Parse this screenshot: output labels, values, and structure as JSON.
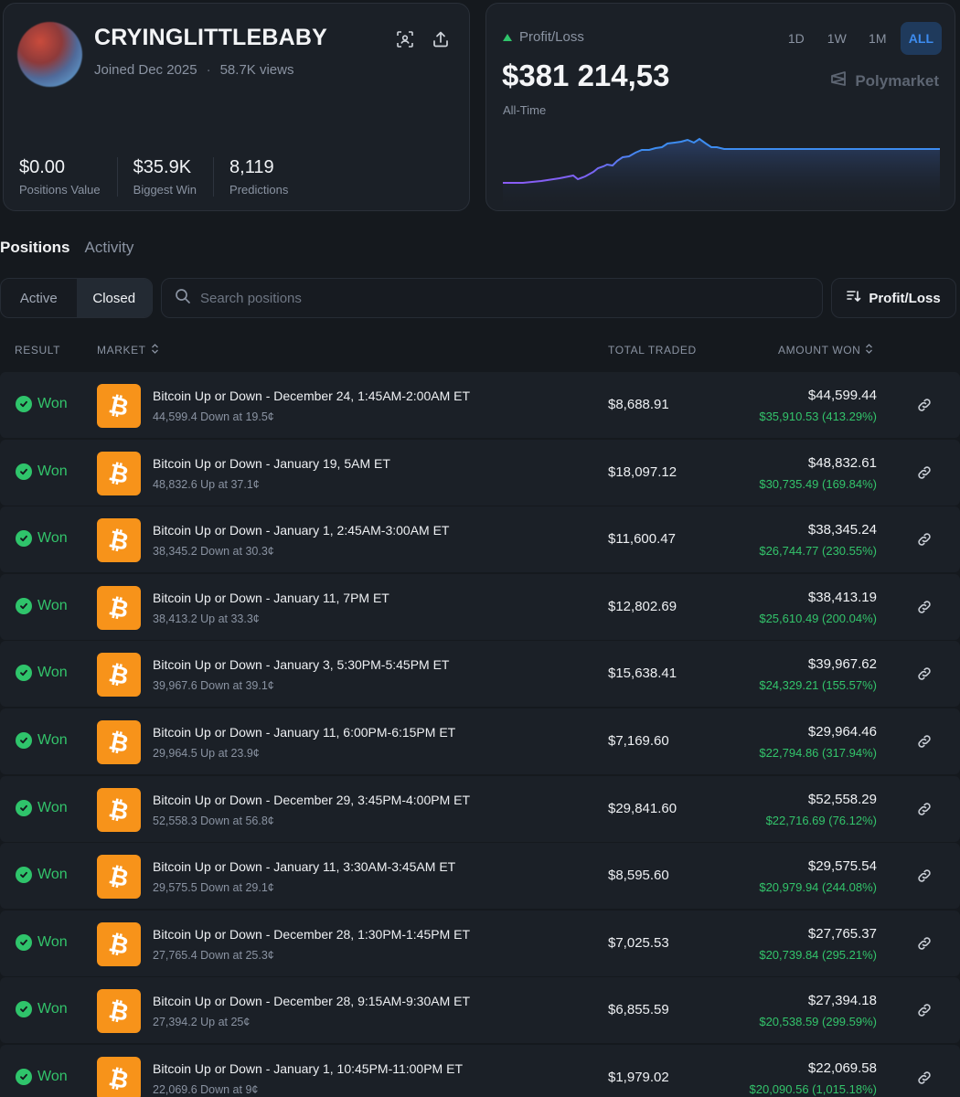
{
  "profile": {
    "username": "CRYINGLITTLEBABY",
    "joined": "Joined Dec 2025",
    "separator": "·",
    "views": "58.7K views",
    "stats": [
      {
        "value": "$0.00",
        "label": "Positions Value"
      },
      {
        "value": "$35.9K",
        "label": "Biggest Win"
      },
      {
        "value": "8,119",
        "label": "Predictions"
      }
    ]
  },
  "pnl": {
    "label": "Profit/Loss",
    "value": "$381 214,53",
    "period": "All-Time",
    "brand": "Polymarket",
    "ranges": [
      "1D",
      "1W",
      "1M",
      "ALL"
    ],
    "active_range": "ALL",
    "colors": {
      "line_start": "#8b5cf6",
      "line_end": "#3d8cf0"
    }
  },
  "tabs": {
    "positions": "Positions",
    "activity": "Activity"
  },
  "filters": {
    "active": "Active",
    "closed": "Closed",
    "search_placeholder": "Search positions",
    "sort_label": "Profit/Loss"
  },
  "table": {
    "headers": {
      "result": "RESULT",
      "market": "MARKET",
      "total_traded": "TOTAL TRADED",
      "amount_won": "AMOUNT WON"
    },
    "rows": [
      {
        "result": "Won",
        "title": "Bitcoin Up or Down - December 24, 1:45AM-2:00AM ET",
        "sub": "44,599.4 Down at 19.5¢",
        "traded": "$8,688.91",
        "won": "$44,599.44",
        "gain": "$35,910.53 (413.29%)"
      },
      {
        "result": "Won",
        "title": "Bitcoin Up or Down - January 19, 5AM ET",
        "sub": "48,832.6 Up at 37.1¢",
        "traded": "$18,097.12",
        "won": "$48,832.61",
        "gain": "$30,735.49 (169.84%)"
      },
      {
        "result": "Won",
        "title": "Bitcoin Up or Down - January 1, 2:45AM-3:00AM ET",
        "sub": "38,345.2 Down at 30.3¢",
        "traded": "$11,600.47",
        "won": "$38,345.24",
        "gain": "$26,744.77 (230.55%)"
      },
      {
        "result": "Won",
        "title": "Bitcoin Up or Down - January 11, 7PM ET",
        "sub": "38,413.2 Up at 33.3¢",
        "traded": "$12,802.69",
        "won": "$38,413.19",
        "gain": "$25,610.49 (200.04%)"
      },
      {
        "result": "Won",
        "title": "Bitcoin Up or Down - January 3, 5:30PM-5:45PM ET",
        "sub": "39,967.6 Down at 39.1¢",
        "traded": "$15,638.41",
        "won": "$39,967.62",
        "gain": "$24,329.21 (155.57%)"
      },
      {
        "result": "Won",
        "title": "Bitcoin Up or Down - January 11, 6:00PM-6:15PM ET",
        "sub": "29,964.5 Up at 23.9¢",
        "traded": "$7,169.60",
        "won": "$29,964.46",
        "gain": "$22,794.86 (317.94%)"
      },
      {
        "result": "Won",
        "title": "Bitcoin Up or Down - December 29, 3:45PM-4:00PM ET",
        "sub": "52,558.3 Down at 56.8¢",
        "traded": "$29,841.60",
        "won": "$52,558.29",
        "gain": "$22,716.69 (76.12%)"
      },
      {
        "result": "Won",
        "title": "Bitcoin Up or Down - January 11, 3:30AM-3:45AM ET",
        "sub": "29,575.5 Down at 29.1¢",
        "traded": "$8,595.60",
        "won": "$29,575.54",
        "gain": "$20,979.94 (244.08%)"
      },
      {
        "result": "Won",
        "title": "Bitcoin Up or Down - December 28, 1:30PM-1:45PM ET",
        "sub": "27,765.4 Down at 25.3¢",
        "traded": "$7,025.53",
        "won": "$27,765.37",
        "gain": "$20,739.84 (295.21%)"
      },
      {
        "result": "Won",
        "title": "Bitcoin Up or Down - December 28, 9:15AM-9:30AM ET",
        "sub": "27,394.2 Up at 25¢",
        "traded": "$6,855.59",
        "won": "$27,394.18",
        "gain": "$20,538.59 (299.59%)"
      },
      {
        "result": "Won",
        "title": "Bitcoin Up or Down - January 1, 10:45PM-11:00PM ET",
        "sub": "22,069.6 Down at 9¢",
        "traded": "$1,979.02",
        "won": "$22,069.58",
        "gain": "$20,090.56 (1,015.18%)"
      }
    ]
  },
  "icons": {
    "scan": "scan-icon",
    "share": "share-icon",
    "search": "search-icon",
    "sort": "sort-icon",
    "check": "check-circle-icon",
    "bitcoin": "bitcoin-icon",
    "link": "link-icon",
    "brand": "polymarket-logo-icon"
  }
}
